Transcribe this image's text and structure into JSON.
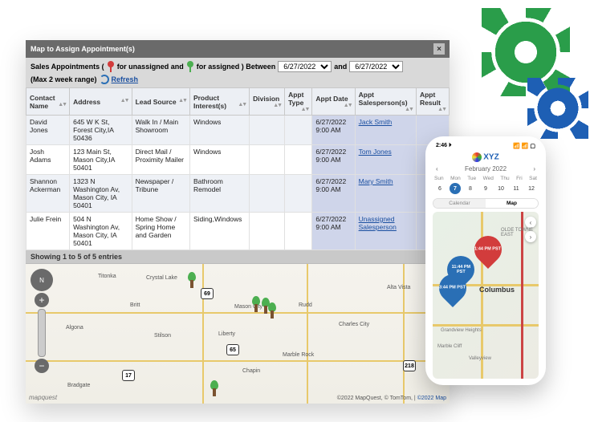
{
  "window": {
    "title": "Map to Assign Appointment(s)",
    "close": "×"
  },
  "filter": {
    "prefix": "Sales Appointments (",
    "unassigned_text": " for unassigned and ",
    "assigned_text": " for assigned ) Between",
    "date_from": "6/27/2022",
    "and": "and",
    "date_to": "6/27/2022",
    "range_note": "(Max 2 week range)",
    "refresh": "Refresh"
  },
  "columns": [
    "Contact Name",
    "Address",
    "Lead Source",
    "Product Interest(s)",
    "Division",
    "Appt Type",
    "Appt Date",
    "Appt Salesperson(s)",
    "Appt Result"
  ],
  "rows": [
    {
      "name": "David Jones",
      "addr": "645 W K St, Forest City,IA 50436",
      "lead": "Walk In / Main Showroom",
      "prod": "Windows",
      "date": "6/27/2022 9:00 AM",
      "sales": "Jack Smith"
    },
    {
      "name": "Josh Adams",
      "addr": "123 Main St, Mason City,IA 50401",
      "lead": "Direct Mail / Proximity Mailer",
      "prod": "Windows",
      "date": "6/27/2022 9:00 AM",
      "sales": "Tom Jones"
    },
    {
      "name": "Shannon Ackerman",
      "addr": "1323 N Washington Av, Mason City, IA 50401",
      "lead": "Newspaper / Tribune",
      "prod": "Bathroom Remodel",
      "date": "6/27/2022 9:00 AM",
      "sales": "Mary Smith"
    },
    {
      "name": "Julie Frein",
      "addr": "504 N Washington Av, Mason City, IA 50401",
      "lead": "Home Show / Spring Home and Garden",
      "prod": "Siding,Windows",
      "date": "6/27/2022 9:00 AM",
      "sales": "Unassigned Salesperson"
    }
  ],
  "footer_count": "Showing 1 to 5 of 5 entries",
  "map": {
    "brand": "mapquest",
    "copyright": "©2022 MapQuest, © TomTom, |",
    "copyright_link": "©2022 Map",
    "cities": [
      "Titonka",
      "Crystal Lake",
      "Britt",
      "Mason City",
      "Rudd",
      "Alta Vista",
      "Algona",
      "Stilson",
      "Liberty",
      "Charles City",
      "Marble Rock",
      "Chapin",
      "Bradgate"
    ],
    "shields": [
      "69",
      "65",
      "17",
      "218"
    ]
  },
  "phone": {
    "time": "2:46 ⏵",
    "status_icons": "📶 📶 ▢",
    "brand": "XYZ",
    "month": "February 2022",
    "weekdays": [
      "Sun",
      "Mon",
      "Tue",
      "Wed",
      "Thu",
      "Fri",
      "Sat"
    ],
    "days": [
      "6",
      "7",
      "8",
      "9",
      "10",
      "11",
      "12"
    ],
    "selected_day_index": 1,
    "tabs": [
      "Calendar",
      "Map"
    ],
    "active_tab": 1,
    "city": "Columbus",
    "areas": [
      "OLDE TOWNE EAST",
      "Grandview Heights",
      "Marble Cliff",
      "Valleyview"
    ],
    "pins": [
      {
        "label": "11:44 PM PST",
        "color": "blue"
      },
      {
        "label": "1:44 PM PST",
        "color": "red"
      },
      {
        "label": "3:44 PM PST",
        "color": "blue"
      }
    ]
  }
}
